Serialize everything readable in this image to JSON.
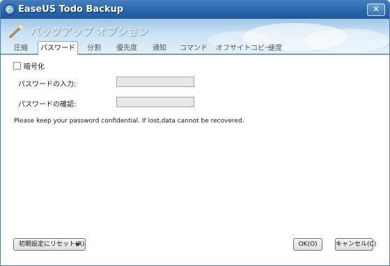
{
  "window": {
    "app_title": "EaseUS Todo Backup",
    "close_label": "✕"
  },
  "header": {
    "title": "バックアップ オプション"
  },
  "tabs": [
    {
      "label": "圧縮",
      "active": false
    },
    {
      "label": "パスワード",
      "active": true
    },
    {
      "label": "分割",
      "active": false
    },
    {
      "label": "優先度",
      "active": false
    },
    {
      "label": "通知",
      "active": false
    },
    {
      "label": "コマンド",
      "active": false
    },
    {
      "label": "オフサイトコピー",
      "active": false
    },
    {
      "label": "速度",
      "active": false
    }
  ],
  "encryption": {
    "checkbox_label": "暗号化",
    "checked": false
  },
  "fields": {
    "password_label": "パスワードの入力:",
    "password_value": "",
    "confirm_label": "パスワードの確認:",
    "confirm_value": ""
  },
  "notice": "Please keep your password confidential. If lost,data cannot be recovered.",
  "buttons": {
    "reset": "初期設定にリセット(R)",
    "ok": "OK(O)",
    "cancel": "キャンセル(C)"
  },
  "icons": {
    "app": "easeus-logo-icon",
    "header": "magic-wand-icon",
    "dropdown": "dropdown-arrow-icon"
  },
  "colors": {
    "titlebar": "#2a66ad",
    "header_band": "#c9e0f3",
    "disabled_input": "#e8e8e8"
  }
}
